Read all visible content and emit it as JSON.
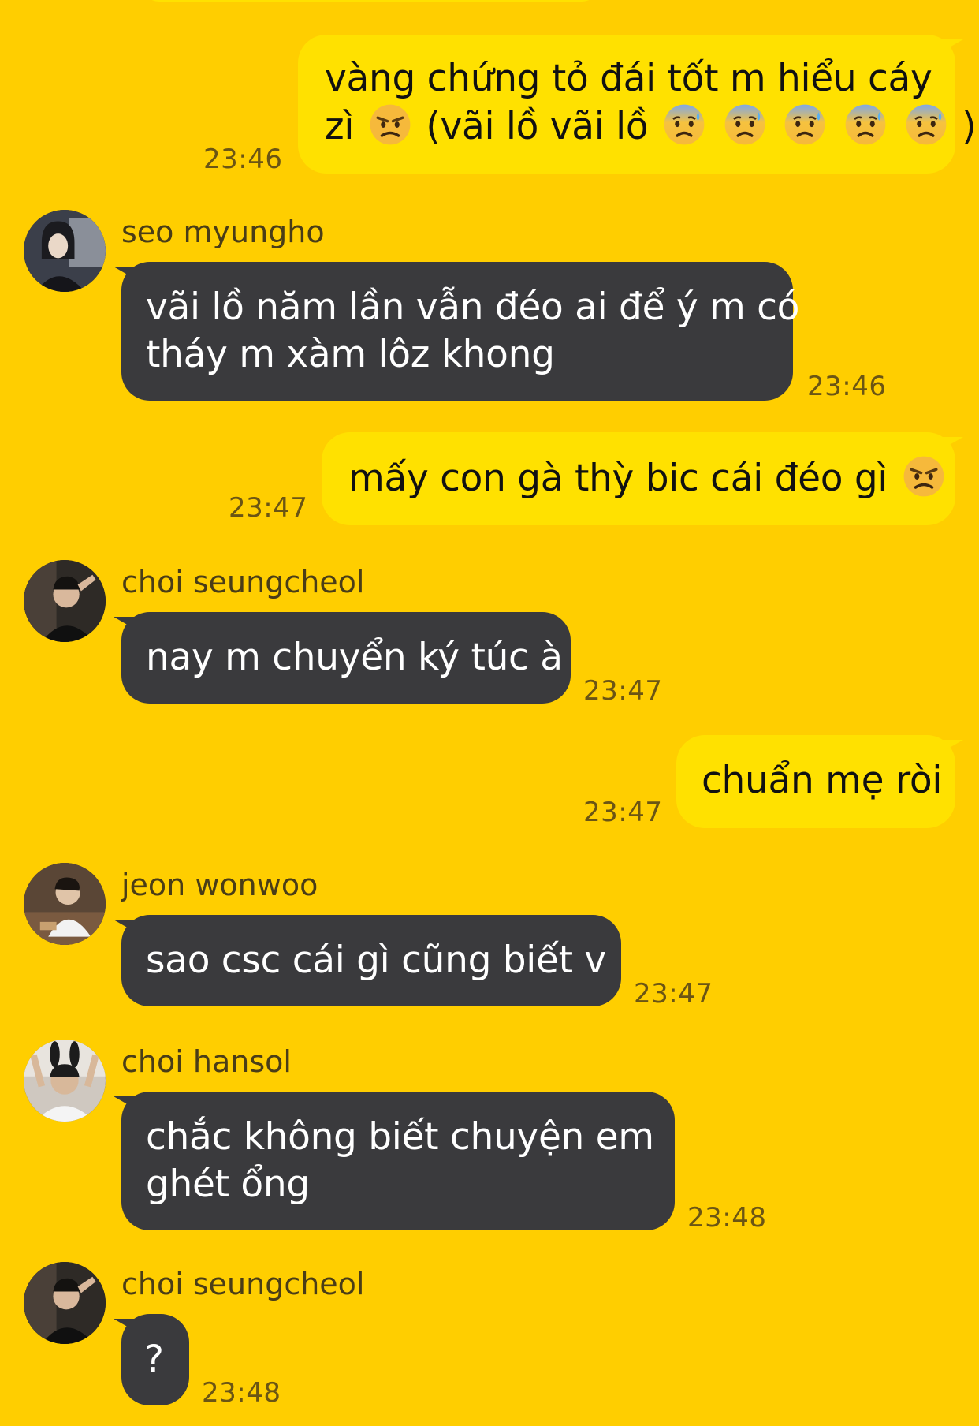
{
  "messages": [
    {
      "id": "m1",
      "direction": "out",
      "text_line1": "vàng chứng tỏ đái tốt m hiểu cáy",
      "text_line2_prefix": "zì",
      "text_line2_mid": "(vãi lồ vãi lồ",
      "text_line2_suffix": ")",
      "emojis": [
        "angry-face",
        "anxious-face-with-sweat",
        "anxious-face-with-sweat",
        "anxious-face-with-sweat",
        "anxious-face-with-sweat",
        "anxious-face-with-sweat"
      ],
      "time": "23:46"
    },
    {
      "id": "m2",
      "direction": "in",
      "sender": "seo myungho",
      "text_line1": "vãi lồ năm lần vẫn đéo ai để ý m có",
      "text_line2": "tháy m xàm lôz khong",
      "time": "23:46"
    },
    {
      "id": "m3",
      "direction": "out",
      "text": "mấy con gà thỳ bic cái đéo gì",
      "emojis": [
        "angry-face"
      ],
      "time": "23:47"
    },
    {
      "id": "m4",
      "direction": "in",
      "sender": "choi seungcheol",
      "text": "nay m chuyển ký túc à",
      "time": "23:47"
    },
    {
      "id": "m5",
      "direction": "out",
      "text": "chuẩn mẹ ròi",
      "time": "23:47"
    },
    {
      "id": "m6",
      "direction": "in",
      "sender": "jeon wonwoo",
      "text": "sao csc cái gì cũng biết v",
      "time": "23:47"
    },
    {
      "id": "m7",
      "direction": "in",
      "sender": "choi hansol",
      "text_line1": "chắc không biết chuyện em",
      "text_line2": "ghét ổng",
      "time": "23:48"
    },
    {
      "id": "m8",
      "direction": "in",
      "sender": "choi seungcheol",
      "text": "?",
      "time": "23:48"
    }
  ],
  "colors": {
    "background": "#FFCE00",
    "outgoing_bubble": "#FFE100",
    "incoming_bubble": "#3A3A3D"
  }
}
